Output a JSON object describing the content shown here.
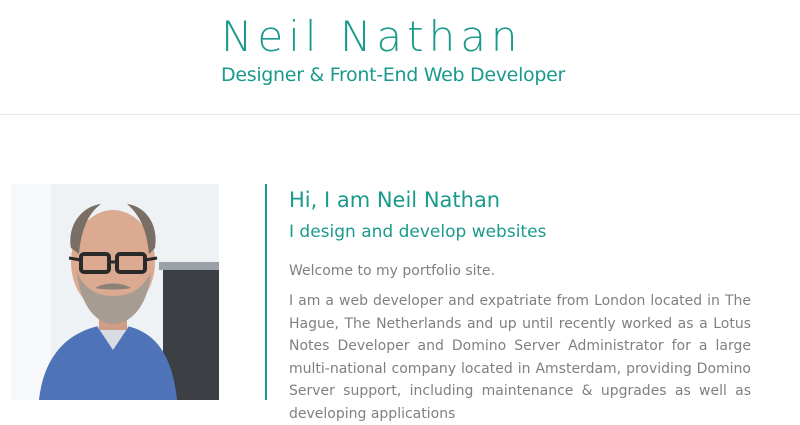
{
  "header": {
    "title": "Neil Nathan",
    "tagline": "Designer & Front-End Web Developer"
  },
  "profile": {
    "photo_icon": "portrait-photo",
    "greeting": "Hi, I am Neil Nathan",
    "subheading": "I design and develop websites",
    "welcome": "Welcome to my portfolio site.",
    "bio": "I am a web developer and expatriate from London located in The Hague, The Netherlands and up until recently worked as a Lotus Notes Developer and Domino Server Administrator for a large multi-national company located in Amsterdam, providing Domino Server support, including maintenance & upgrades as well as developing applications"
  },
  "colors": {
    "accent": "#1a9a8c",
    "body_text": "#808080",
    "divider": "#e6e6e6"
  }
}
